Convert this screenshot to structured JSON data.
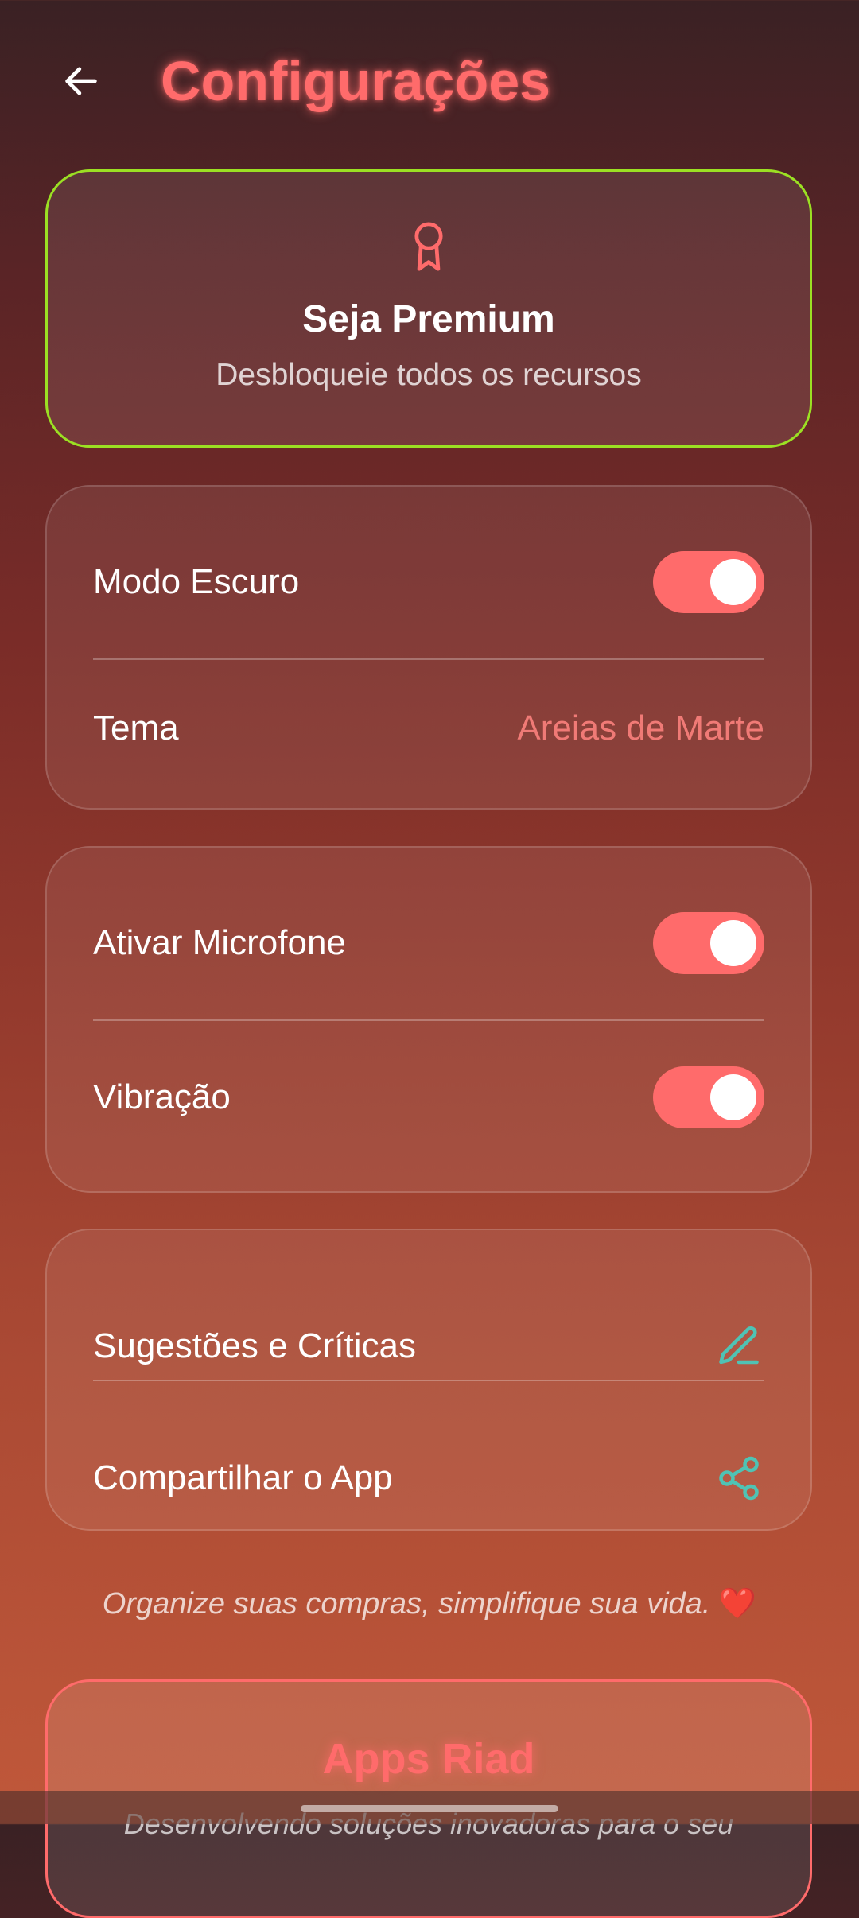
{
  "header": {
    "title": "Configurações",
    "back_icon": "arrow-left-icon"
  },
  "premium": {
    "icon": "award-icon",
    "title": "Seja Premium",
    "subtitle": "Desbloqueie todos os recursos",
    "border_color": "#9be023"
  },
  "appearance": {
    "dark_mode": {
      "label": "Modo Escuro",
      "enabled": true
    },
    "theme": {
      "label": "Tema",
      "value": "Areias de Marte"
    }
  },
  "controls": {
    "microphone": {
      "label": "Ativar Microfone",
      "enabled": true
    },
    "vibration": {
      "label": "Vibração",
      "enabled": true
    }
  },
  "extras": {
    "feedback": {
      "label": "Sugestões e Críticas",
      "icon": "pencil-icon"
    },
    "share": {
      "label": "Compartilhar o App",
      "icon": "share-icon"
    }
  },
  "tagline": {
    "text": "Organize suas compras, simplifique sua vida.",
    "emoji": "❤️"
  },
  "footer_card": {
    "title": "Apps Riad",
    "subtitle": "Desenvolvendo soluções inovadoras para o seu"
  },
  "colors": {
    "accent": "#ff6b6b",
    "teal_icon": "#4fc3b4",
    "premium_border": "#9be023"
  }
}
